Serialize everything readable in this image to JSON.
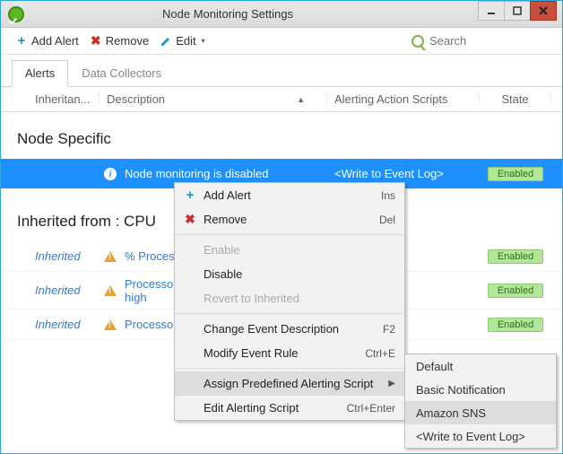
{
  "window": {
    "title": "Node Monitoring Settings"
  },
  "toolbar": {
    "add_alert": "Add Alert",
    "remove": "Remove",
    "edit": "Edit",
    "search_placeholder": "Search"
  },
  "tabs": {
    "alerts": "Alerts",
    "data_collectors": "Data Collectors"
  },
  "columns": {
    "inheritance": "Inheritan...",
    "description": "Description",
    "alerting_scripts": "Alerting Action Scripts",
    "state": "State"
  },
  "sections": {
    "node_specific": "Node Specific",
    "inherited_cpu": "Inherited from : CPU"
  },
  "node_row": {
    "description": "Node monitoring is disabled",
    "script": "<Write to Event Log>",
    "state": "Enabled"
  },
  "inherited_label": "Inherited",
  "cpu_rows": [
    {
      "description_short": "% Processor",
      "state": "Enabled"
    },
    {
      "description_short_line1": "Processor t",
      "description_short_line2": "high",
      "state": "Enabled"
    },
    {
      "description_short": "Processor t",
      "state": "Enabled"
    }
  ],
  "ctx": {
    "add_alert": {
      "label": "Add Alert",
      "shortcut": "Ins"
    },
    "remove": {
      "label": "Remove",
      "shortcut": "Del"
    },
    "enable": {
      "label": "Enable"
    },
    "disable": {
      "label": "Disable"
    },
    "revert": {
      "label": "Revert to Inherited"
    },
    "change_desc": {
      "label": "Change Event Description",
      "shortcut": "F2"
    },
    "modify_rule": {
      "label": "Modify Event Rule",
      "shortcut": "Ctrl+E"
    },
    "assign_script": {
      "label": "Assign Predefined Alerting Script"
    },
    "edit_script": {
      "label": "Edit Alerting Script",
      "shortcut": "Ctrl+Enter"
    }
  },
  "submenu": {
    "default": "Default",
    "basic": "Basic Notification",
    "sns": "Amazon SNS",
    "wel": "<Write to Event Log>"
  }
}
